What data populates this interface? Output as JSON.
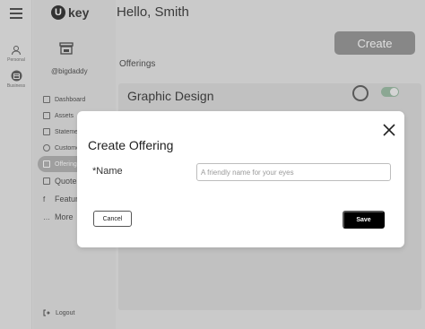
{
  "rail": {
    "items": [
      {
        "label": "Personal",
        "icon": "person-icon"
      },
      {
        "label": "Business",
        "icon": "business-icon"
      }
    ]
  },
  "sidebar": {
    "logo_word": "key",
    "logo_letter": "U",
    "handle": "@bigdaddy",
    "items": [
      {
        "label": "Dashboard",
        "icon": "dashboard-icon"
      },
      {
        "label": "Assets",
        "icon": "assets-icon"
      },
      {
        "label": "Statements",
        "icon": "statements-icon"
      },
      {
        "label": "Customers",
        "icon": "customers-icon"
      },
      {
        "label": "Offerings",
        "icon": "offerings-icon"
      },
      {
        "label": "Quotes",
        "icon": "quotes-icon"
      },
      {
        "label": "Features",
        "icon": "features-icon"
      },
      {
        "label": "More",
        "icon": "more-icon"
      }
    ],
    "logout": "Logout"
  },
  "header": {
    "greeting": "Hello, Smith",
    "create_label": "Create"
  },
  "main": {
    "section_title": "Offerings",
    "card": {
      "title": "Graphic Design",
      "toggle_on": true
    }
  },
  "modal": {
    "title": "Create Offering",
    "name_label": "*Name",
    "name_placeholder": "A friendly name for your eyes",
    "name_value": "",
    "cancel_label": "Cancel",
    "save_label": "Save"
  },
  "colors": {
    "accent_toggle": "#9fbfa8",
    "primary_button": "#000000",
    "overlay": "rgba(0,0,0,0.12)"
  }
}
